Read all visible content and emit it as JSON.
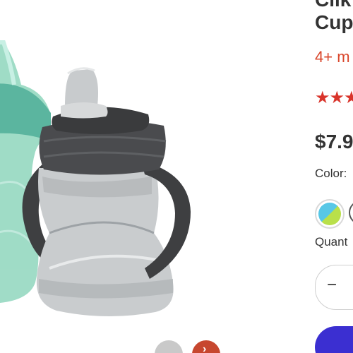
{
  "product": {
    "title_line1": "Clik",
    "title_line2": "Cup",
    "age": "4+ m",
    "rating_stars": "★★★",
    "price": "$7.9",
    "color_label": "Color:",
    "quantity_label": "Quant",
    "quantity_minus": "−"
  },
  "gallery": {
    "next_arrow": "›"
  },
  "colors": {
    "accent": "#d9462b",
    "cart_button": "#3b2fd1"
  }
}
